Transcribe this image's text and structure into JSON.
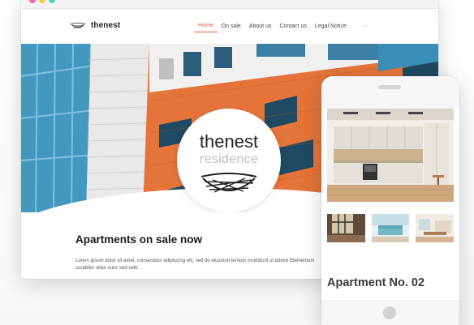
{
  "window": {
    "traffic_lights": [
      "#f56aa6",
      "#f8c93f",
      "#4fd1c5"
    ]
  },
  "site": {
    "brand": "thenest",
    "nav": [
      {
        "label": "Home",
        "active": true
      },
      {
        "label": "On sale",
        "active": false
      },
      {
        "label": "About us",
        "active": false
      },
      {
        "label": "Contact us",
        "active": false
      },
      {
        "label": "Legal Notice",
        "active": false
      }
    ],
    "nav_more": "···",
    "accent_color": "#e8613c"
  },
  "hero": {
    "logo_name": "thenest",
    "logo_tagline": "residence"
  },
  "content": {
    "heading": "Apartments on sale now",
    "body": "Lorem ipsum dolor sit amet, consectetur adipiscing elit, sed do eiusmod tempor incididunt ut labore Elementum curabitur vitae nunc sed velit."
  },
  "mobile": {
    "apartment_title": "Apartment No. 02",
    "thumbnail_count": 3
  }
}
